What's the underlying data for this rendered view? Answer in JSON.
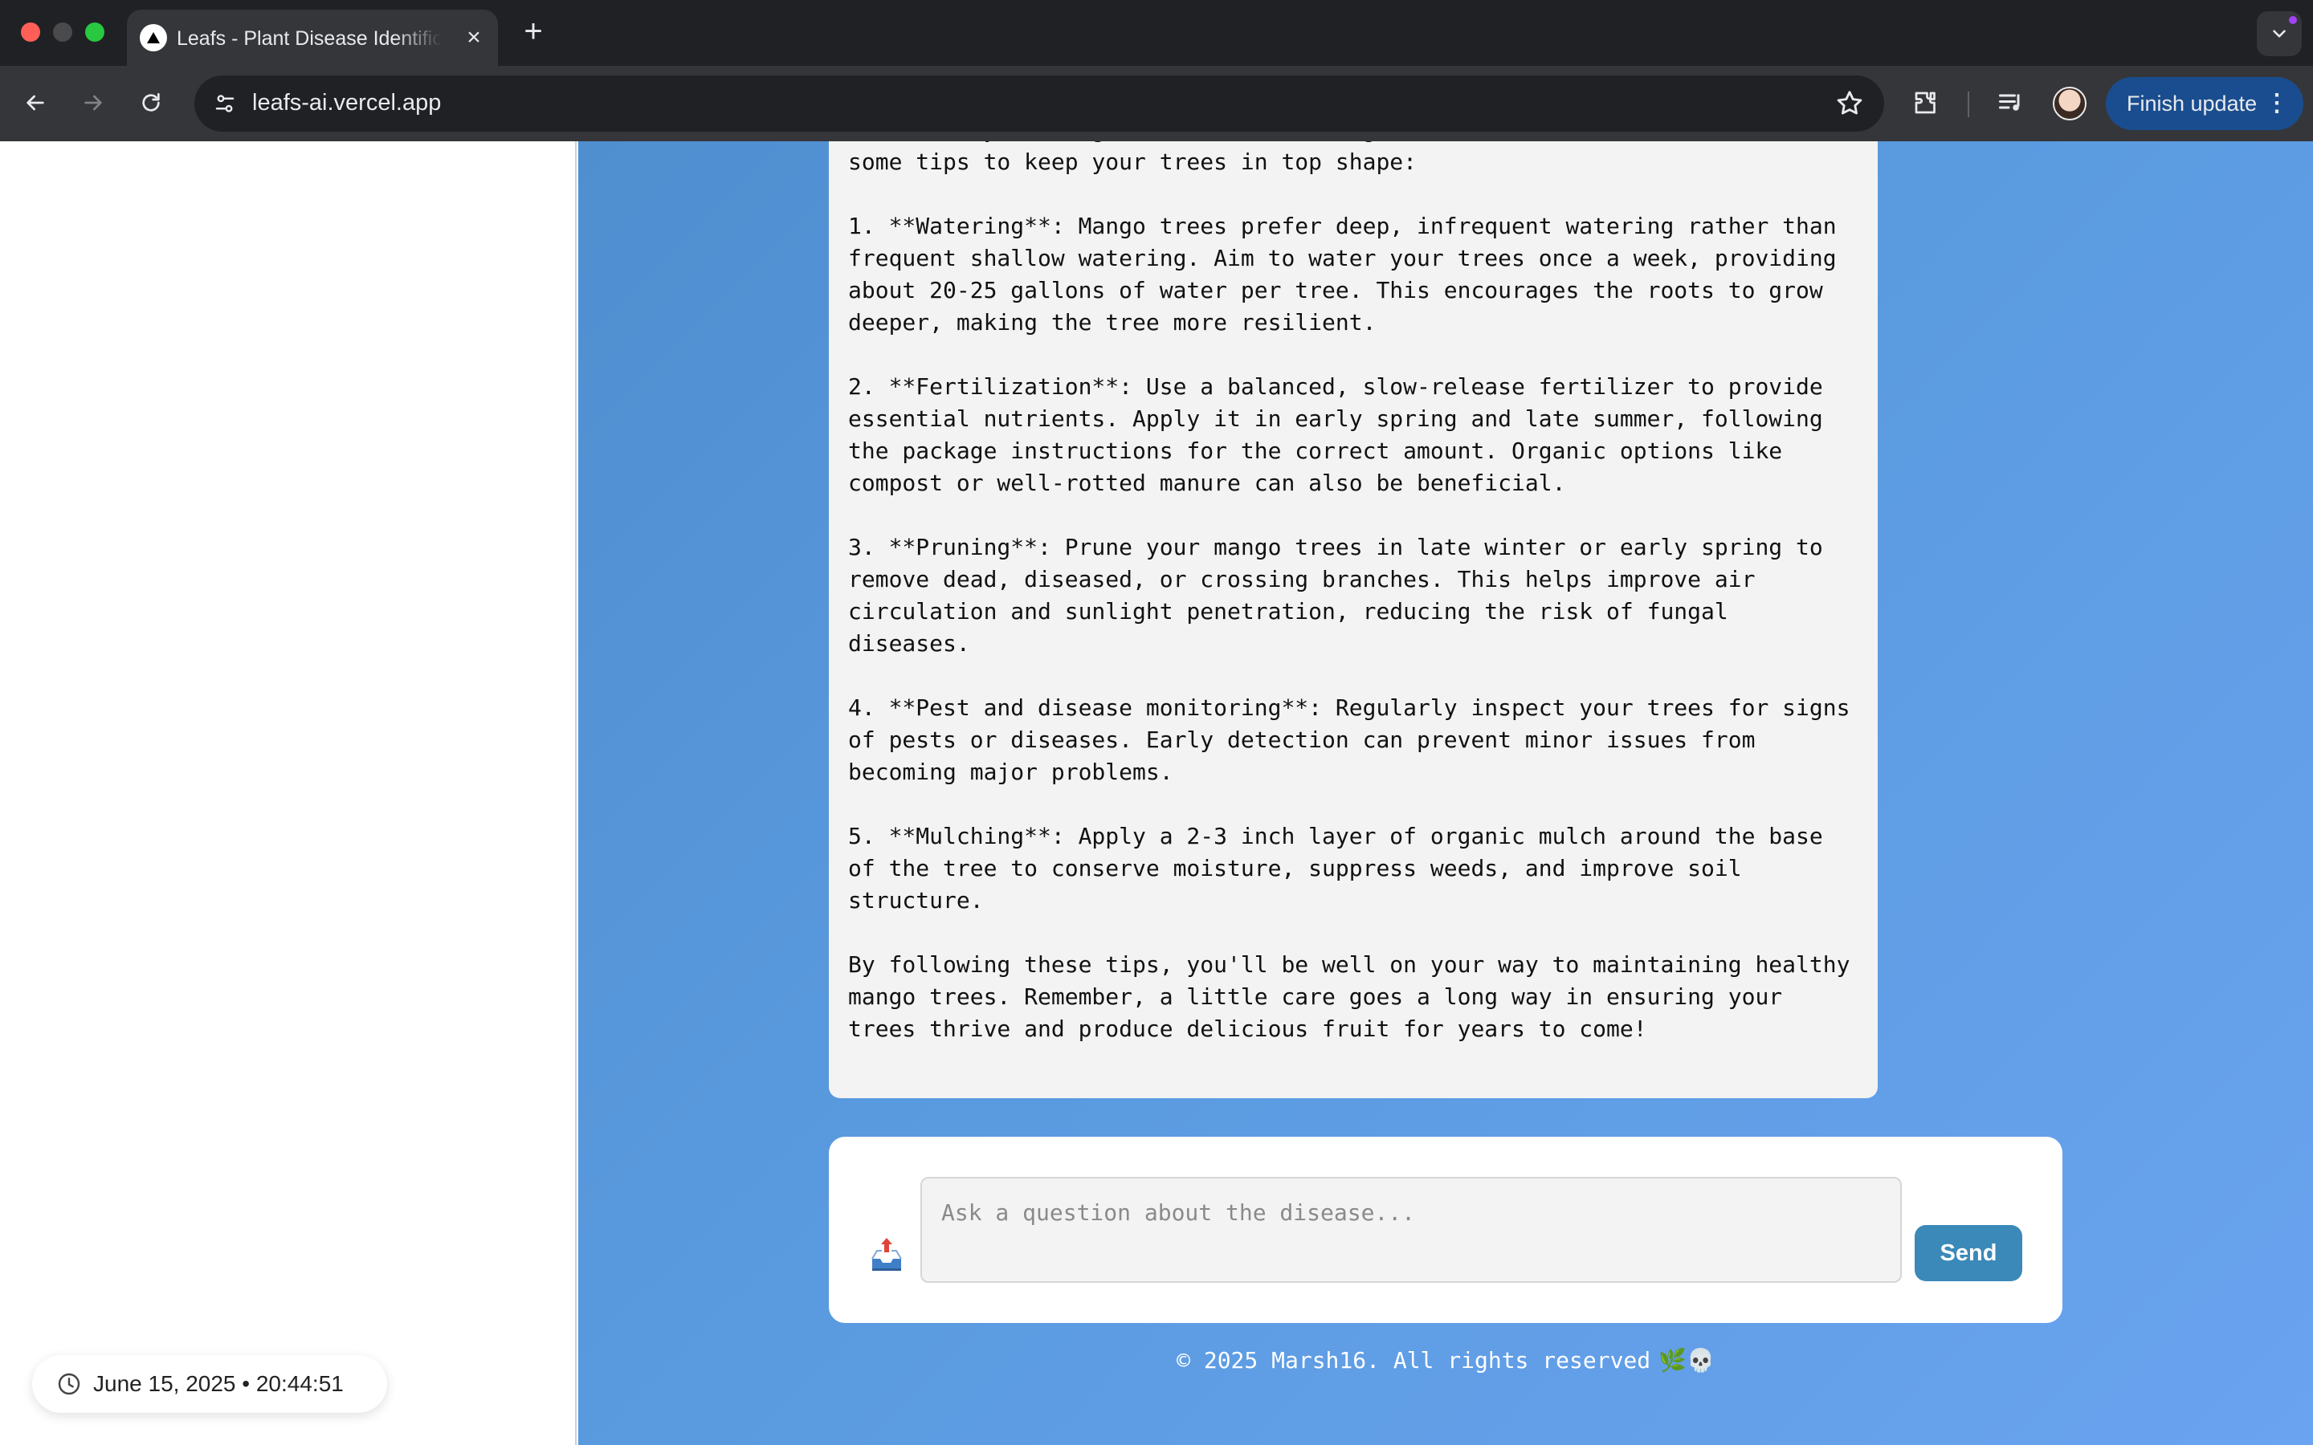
{
  "browser": {
    "tab_title": "Leafs - Plant Disease Identification",
    "tab_close": "×",
    "new_tab": "+",
    "url": "leafs-ai.vercel.app",
    "finish_update": "Finish update",
    "menu_dots": "⋮"
  },
  "chat": {
    "answer_text": "health of your mango trees involves regular care and attention. Here are some tips to keep your trees in top shape:\n\n1. **Watering**: Mango trees prefer deep, infrequent watering rather than frequent shallow watering. Aim to water your trees once a week, providing about 20-25 gallons of water per tree. This encourages the roots to grow deeper, making the tree more resilient.\n\n2. **Fertilization**: Use a balanced, slow-release fertilizer to provide essential nutrients. Apply it in early spring and late summer, following the package instructions for the correct amount. Organic options like compost or well-rotted manure can also be beneficial.\n\n3. **Pruning**: Prune your mango trees in late winter or early spring to remove dead, diseased, or crossing branches. This helps improve air circulation and sunlight penetration, reducing the risk of fungal diseases.\n\n4. **Pest and disease monitoring**: Regularly inspect your trees for signs of pests or diseases. Early detection can prevent minor issues from becoming major problems.\n\n5. **Mulching**: Apply a 2-3 inch layer of organic mulch around the base of the tree to conserve moisture, suppress weeds, and improve soil structure.\n\nBy following these tips, you'll be well on your way to maintaining healthy mango trees. Remember, a little care goes a long way in ensuring your trees thrive and produce delicious fruit for years to come!",
    "input_placeholder": "Ask a question about the disease...",
    "input_value": "",
    "send_label": "Send"
  },
  "footer": {
    "text": "© 2025 Marsh16. All rights reserved",
    "emoji": "🌿💀"
  },
  "timestamp": "June 15, 2025 • 20:44:51",
  "colors": {
    "accent_button": "#3b89b8",
    "main_gradient_start": "#4f8fd0",
    "main_gradient_end": "#6aa3f0",
    "update_pill": "#1a4d8f"
  }
}
